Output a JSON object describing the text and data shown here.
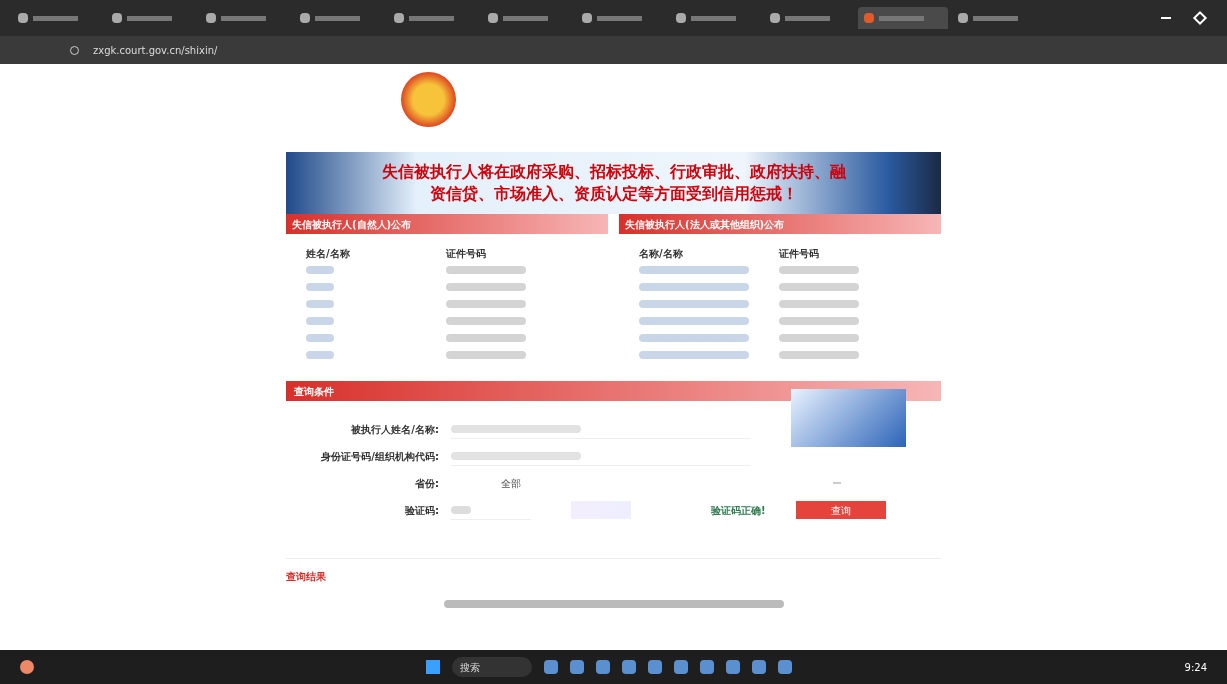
{
  "browser": {
    "tabs": [
      {
        "selected": false
      },
      {
        "selected": false
      },
      {
        "selected": false
      },
      {
        "selected": false
      },
      {
        "selected": false
      },
      {
        "selected": false
      },
      {
        "selected": false
      },
      {
        "selected": false
      },
      {
        "selected": false
      },
      {
        "selected": true
      },
      {
        "selected": false
      }
    ],
    "address": "zxgk.court.gov.cn/shixin/"
  },
  "banner": {
    "lines": [
      "失信被执行人将在政府采购、招标投标、行政审批、政府扶持、融",
      "资信贷、市场准入、资质认定等方面受到信用惩戒！"
    ]
  },
  "sections": [
    {
      "title": "失信被执行人(自然人)公布",
      "columns": [
        "姓名/名称",
        "证件号码"
      ],
      "rows": [
        {
          "kind": "blurred"
        },
        {
          "kind": "blurred"
        },
        {
          "kind": "blurred"
        },
        {
          "kind": "blurred"
        },
        {
          "kind": "blurred"
        },
        {
          "kind": "blurred"
        }
      ]
    },
    {
      "title": "失信被执行人(法人或其他组织)公布",
      "columns": [
        "名称/名称",
        "证件号码"
      ],
      "rows": [
        {
          "kind": "blurred"
        },
        {
          "kind": "blurred"
        },
        {
          "kind": "blurred"
        },
        {
          "kind": "blurred"
        },
        {
          "kind": "blurred"
        },
        {
          "kind": "blurred"
        }
      ]
    }
  ],
  "query": {
    "title": "查询条件",
    "fields": [
      {
        "label": "被执行人姓名/名称:",
        "kind": "text"
      },
      {
        "label": "身份证号码/组织机构代码:",
        "kind": "text"
      },
      {
        "label": "省份:",
        "kind": "select",
        "value": "全部"
      },
      {
        "label": "验证码:",
        "kind": "captcha",
        "status": "验证码正确!"
      }
    ],
    "button": "查询"
  },
  "results": {
    "title": "查询结果"
  },
  "taskbar": {
    "search": "搜索",
    "time": "9:24"
  }
}
